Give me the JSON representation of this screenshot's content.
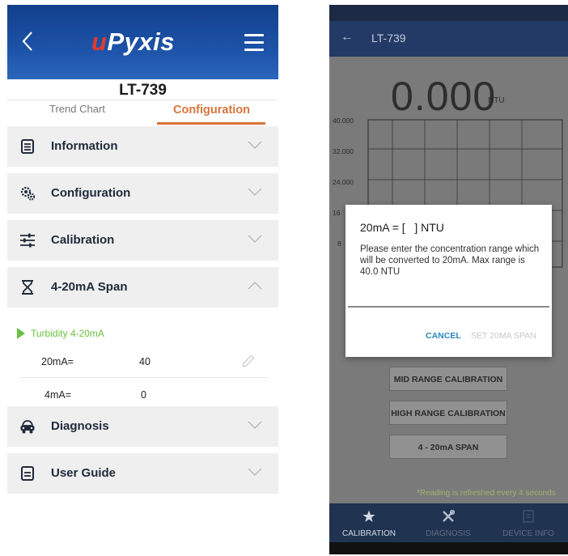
{
  "left": {
    "logo_prefix": "u",
    "logo_rest": "Pyxis",
    "device_title": "LT-739",
    "tabs": [
      {
        "label": "Trend Chart",
        "active": false
      },
      {
        "label": "Configuration",
        "active": true
      }
    ],
    "sections": [
      {
        "label": "Information",
        "icon": "document-list-icon",
        "expanded": false
      },
      {
        "label": "Configuration",
        "icon": "gears-icon",
        "expanded": false
      },
      {
        "label": "Calibration",
        "icon": "sliders-icon",
        "expanded": false
      },
      {
        "label": "4-20mA Span",
        "icon": "hourglass-icon",
        "expanded": true
      },
      {
        "label": "Diagnosis",
        "icon": "car-icon",
        "expanded": false
      },
      {
        "label": "User Guide",
        "icon": "book-icon",
        "expanded": false
      }
    ],
    "span": {
      "subheader": "Turbidity 4-20mA",
      "rows": [
        {
          "label": "20mA=",
          "value": "40"
        },
        {
          "label": "4mA=",
          "value": "0"
        }
      ]
    },
    "colors": {
      "header": "#1d53a8",
      "accent": "#d9743b",
      "green": "#6ac13f"
    }
  },
  "right": {
    "header_title": "LT-739",
    "reading": "0.000",
    "unit": "NTU",
    "chart_y_labels": [
      "40.000",
      "32.000",
      "24.000",
      "16",
      "8"
    ],
    "buttons": [
      "MID RANGE CALIBRATION",
      "HIGH RANGE CALIBRATION",
      "4 - 20mA SPAN"
    ],
    "note": "*Reading is refreshed every 4 seconds",
    "dialog": {
      "title": "20mA = [   ] NTU",
      "message": "Please enter the concentration range which will be converted to 20mA. Max range is 40.0 NTU",
      "cancel_label": "CANCEL",
      "confirm_label": "SET 20MA SPAN"
    },
    "nav": [
      {
        "label": "CALIBRATION",
        "icon": "star-icon",
        "active": true
      },
      {
        "label": "DIAGNOSIS",
        "icon": "tools-icon",
        "active": false
      },
      {
        "label": "DEVICE INFO",
        "icon": "info-card-icon",
        "active": false
      }
    ]
  }
}
